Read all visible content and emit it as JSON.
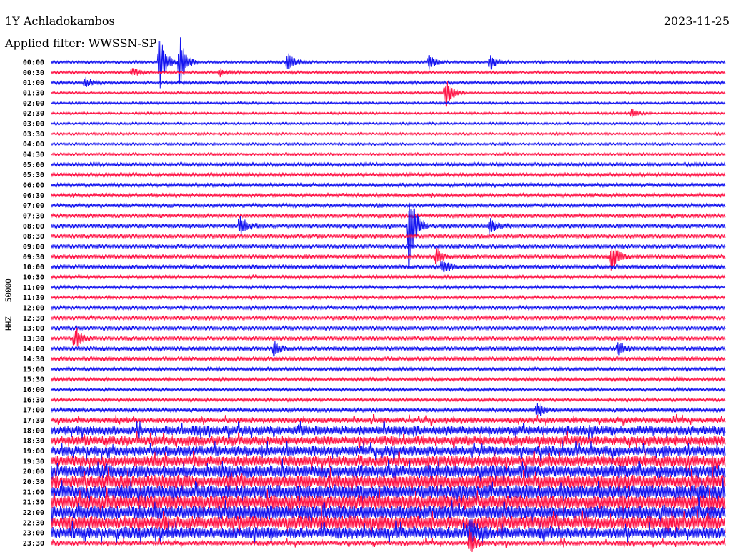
{
  "header": {
    "station": "1Y Achladokambos",
    "date": "2023-11-25",
    "filter": "Applied filter: WWSSN-SP"
  },
  "chart_data": {
    "type": "line",
    "title": "1Y Achladokambos",
    "ylabel": "HHZ - 50000",
    "colors": [
      "#1414f0",
      "#ff1446"
    ],
    "row_labels": [
      "00:00",
      "00:30",
      "01:00",
      "01:30",
      "02:00",
      "02:30",
      "03:00",
      "03:30",
      "04:00",
      "04:30",
      "05:00",
      "05:30",
      "06:00",
      "06:30",
      "07:00",
      "07:30",
      "08:00",
      "08:30",
      "09:00",
      "09:30",
      "10:00",
      "10:30",
      "11:00",
      "11:30",
      "12:00",
      "12:30",
      "13:00",
      "13:30",
      "14:00",
      "14:30",
      "15:00",
      "15:30",
      "16:00",
      "16:30",
      "17:00",
      "17:30",
      "18:00",
      "18:30",
      "19:00",
      "19:30",
      "20:00",
      "20:30",
      "21:00",
      "21:30",
      "22:00",
      "22:30",
      "23:00",
      "23:30"
    ],
    "relative_noise": [
      1.6,
      1.6,
      1.8,
      1.4,
      1.4,
      1.4,
      1.4,
      1.4,
      1.5,
      1.6,
      2.2,
      2.3,
      2.6,
      2.8,
      2.8,
      2.8,
      3.0,
      2.8,
      2.6,
      2.6,
      2.6,
      2.2,
      2.0,
      2.0,
      2.2,
      2.4,
      2.4,
      2.4,
      2.6,
      2.4,
      2.0,
      2.0,
      1.8,
      1.8,
      2.6,
      3.6,
      6,
      6,
      6.5,
      7,
      8,
      8.5,
      9,
      9,
      9,
      8.5,
      7.5,
      3
    ],
    "events": [
      {
        "row": 0,
        "t": 0.16,
        "amp": 40
      },
      {
        "row": 0,
        "t": 0.19,
        "amp": 38
      },
      {
        "row": 0,
        "t": 0.35,
        "amp": 16
      },
      {
        "row": 0,
        "t": 0.56,
        "amp": 12
      },
      {
        "row": 0,
        "t": 0.65,
        "amp": 12
      },
      {
        "row": 1,
        "t": 0.12,
        "amp": 8
      },
      {
        "row": 1,
        "t": 0.25,
        "amp": 6
      },
      {
        "row": 2,
        "t": 0.05,
        "amp": 8
      },
      {
        "row": 3,
        "t": 0.585,
        "amp": 22
      },
      {
        "row": 5,
        "t": 0.86,
        "amp": 6
      },
      {
        "row": 16,
        "t": 0.53,
        "amp": 60
      },
      {
        "row": 16,
        "t": 0.28,
        "amp": 14
      },
      {
        "row": 16,
        "t": 0.65,
        "amp": 10
      },
      {
        "row": 19,
        "t": 0.83,
        "amp": 20
      },
      {
        "row": 19,
        "t": 0.57,
        "amp": 14
      },
      {
        "row": 20,
        "t": 0.58,
        "amp": 12
      },
      {
        "row": 27,
        "t": 0.035,
        "amp": 18
      },
      {
        "row": 28,
        "t": 0.33,
        "amp": 10
      },
      {
        "row": 28,
        "t": 0.84,
        "amp": 12
      },
      {
        "row": 34,
        "t": 0.72,
        "amp": 12
      },
      {
        "row": 46,
        "t": 0.62,
        "amp": 20
      },
      {
        "row": 47,
        "t": 0.62,
        "amp": 18
      }
    ]
  }
}
